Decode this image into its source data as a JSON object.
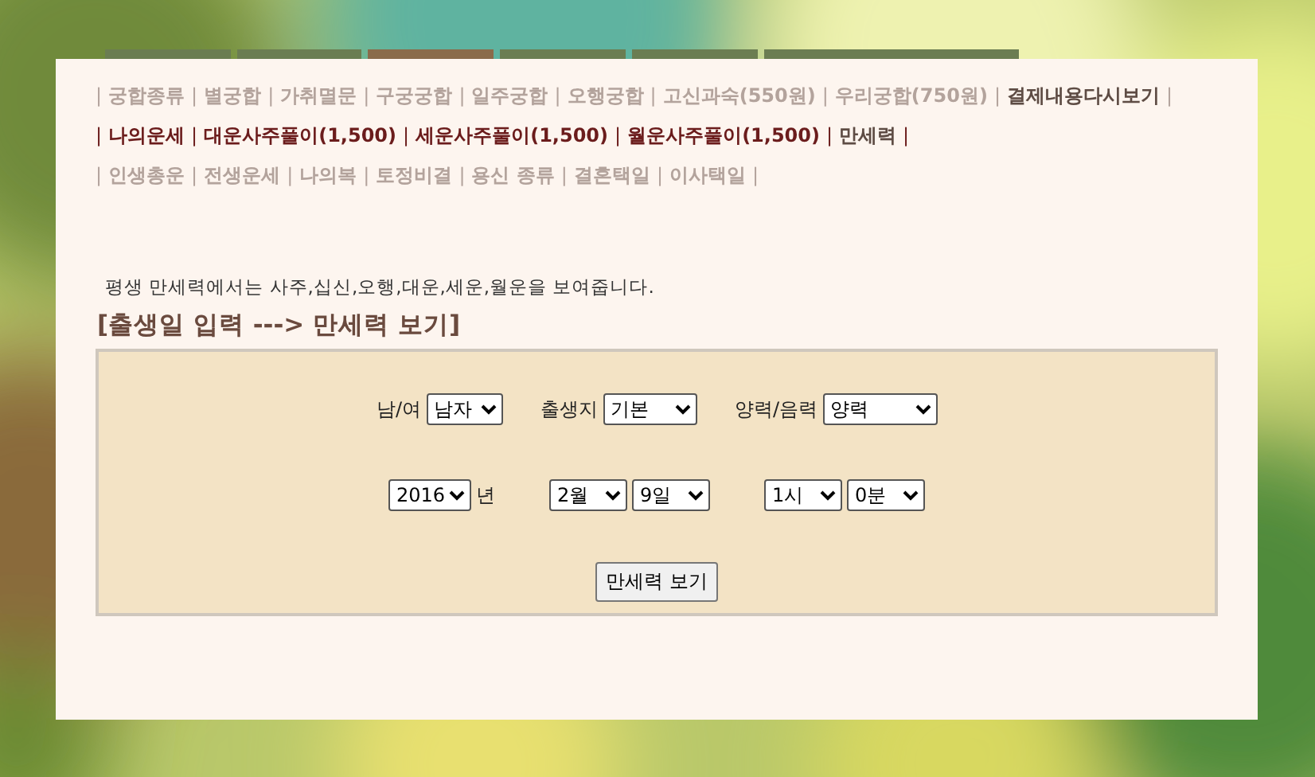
{
  "menu": [
    {
      "segments": [
        {
          "kind": "sep",
          "text": "|"
        },
        {
          "kind": "link",
          "text": "궁합종류"
        },
        {
          "kind": "sep",
          "text": "|"
        },
        {
          "kind": "link",
          "text": "별궁합"
        },
        {
          "kind": "sep",
          "text": "|"
        },
        {
          "kind": "link",
          "text": "가취멸문"
        },
        {
          "kind": "sep",
          "text": "|"
        },
        {
          "kind": "link",
          "text": "구궁궁합"
        },
        {
          "kind": "sep",
          "text": "|"
        },
        {
          "kind": "link",
          "text": "일주궁합"
        },
        {
          "kind": "sep",
          "text": "|"
        },
        {
          "kind": "link",
          "text": "오행궁합"
        },
        {
          "kind": "sep",
          "text": "|"
        },
        {
          "kind": "link",
          "text": "고신과숙(550원)"
        },
        {
          "kind": "sep",
          "text": "|"
        },
        {
          "kind": "link",
          "text": "우리궁합(750원)"
        },
        {
          "kind": "sep",
          "text": "|"
        },
        {
          "kind": "link-dark",
          "text": "결제내용다시보기"
        },
        {
          "kind": "sep",
          "text": "|"
        }
      ]
    },
    {
      "segments": [
        {
          "kind": "sep-dark",
          "text": "|"
        },
        {
          "kind": "link-strong",
          "text": "나의운세"
        },
        {
          "kind": "sep-dark",
          "text": "|"
        },
        {
          "kind": "link-strong",
          "text": "대운사주풀이(1,500)"
        },
        {
          "kind": "sep-dark",
          "text": "|"
        },
        {
          "kind": "link-strong",
          "text": "세운사주풀이(1,500)"
        },
        {
          "kind": "sep-dark",
          "text": "|"
        },
        {
          "kind": "link-strong",
          "text": "월운사주풀이(1,500)"
        },
        {
          "kind": "sep-dark",
          "text": "|"
        },
        {
          "kind": "link-dark",
          "text": "만세력"
        },
        {
          "kind": "sep-dark",
          "text": "|"
        }
      ]
    },
    {
      "segments": [
        {
          "kind": "sep",
          "text": "|"
        },
        {
          "kind": "link",
          "text": "인생총운"
        },
        {
          "kind": "sep",
          "text": "|"
        },
        {
          "kind": "link",
          "text": "전생운세"
        },
        {
          "kind": "sep",
          "text": "|"
        },
        {
          "kind": "link",
          "text": "나의복"
        },
        {
          "kind": "sep",
          "text": "|"
        },
        {
          "kind": "link",
          "text": "토정비결"
        },
        {
          "kind": "sep",
          "text": "|"
        },
        {
          "kind": "link",
          "text": "용신 종류"
        },
        {
          "kind": "sep",
          "text": "|"
        },
        {
          "kind": "link",
          "text": "결혼택일"
        },
        {
          "kind": "sep",
          "text": "|"
        },
        {
          "kind": "link",
          "text": "이사택일"
        },
        {
          "kind": "sep",
          "text": "|"
        }
      ]
    }
  ],
  "description": "평생 만세력에서는 사주,십신,오행,대운,세운,월운을 보여줍니다.",
  "heading": "[출생일 입력 ---> 만세력 보기]",
  "form": {
    "row_1": [
      {
        "label": "남/여",
        "value": "남자"
      },
      {
        "label": "출생지",
        "value": "기본"
      },
      {
        "label": "양력/음력",
        "value": "양력"
      }
    ],
    "row_2": {
      "year": "2016",
      "year_unit": "년",
      "month": "2월",
      "day": "9일",
      "hour": "1시",
      "minute": "0분"
    },
    "submit": "만세력 보기"
  }
}
